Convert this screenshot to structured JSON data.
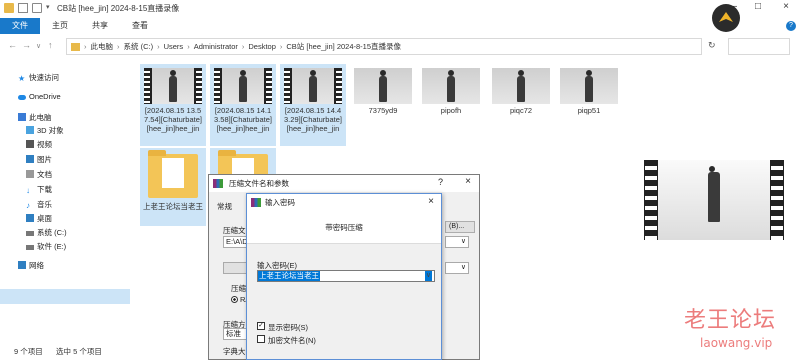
{
  "window": {
    "title": "CB站 [hee_jin] 2024-8-15直播录像",
    "controls": [
      "—",
      "□",
      "×"
    ]
  },
  "ribbon": {
    "tabs": [
      "文件",
      "主页",
      "共享",
      "查看"
    ],
    "help_icon": "?"
  },
  "address": {
    "crumbs": [
      "此电脑",
      "系统 (C:)",
      "Users",
      "Administrator",
      "Desktop",
      "CB站 [hee_jin] 2024-8-15直播录像"
    ],
    "refresh": "↻"
  },
  "sidebar": {
    "items": [
      {
        "label": "快速访问",
        "icon": "star-icon",
        "color": "#1e88e5"
      },
      {
        "label": "OneDrive",
        "icon": "cloud-icon",
        "color": "#1e88e5"
      },
      {
        "label": "此电脑",
        "icon": "computer-icon",
        "color": "#3a7bd5"
      },
      {
        "label": "3D 对象",
        "icon": "cube-icon",
        "color": "#4aa3df"
      },
      {
        "label": "视频",
        "icon": "video-icon",
        "color": "#555"
      },
      {
        "label": "图片",
        "icon": "picture-icon",
        "color": "#2f7fc1"
      },
      {
        "label": "文档",
        "icon": "document-icon",
        "color": "#777"
      },
      {
        "label": "下载",
        "icon": "download-icon",
        "color": "#1e88e5"
      },
      {
        "label": "音乐",
        "icon": "music-icon",
        "color": "#1e88e5"
      },
      {
        "label": "桌面",
        "icon": "desktop-icon",
        "color": "#2f7fc1"
      },
      {
        "label": "系统 (C:)",
        "icon": "drive-icon",
        "color": "#666"
      },
      {
        "label": "软件 (E:)",
        "icon": "drive-icon",
        "color": "#666"
      },
      {
        "label": "网络",
        "icon": "network-icon",
        "color": "#2f7fc1"
      }
    ]
  },
  "files": [
    {
      "name": "[2024.08.15 13.57.54][Chaturbate][hee_jin]hee_jin",
      "type": "video",
      "selected": true
    },
    {
      "name": "[2024.08.15 14.13.58][Chaturbate][hee_jin]hee_jin",
      "type": "video",
      "selected": true
    },
    {
      "name": "[2024.08.15 14.43.29][Chaturbate][hee_jin]hee_jin",
      "type": "video",
      "selected": true
    },
    {
      "name": "7375yd9",
      "type": "image",
      "selected": false
    },
    {
      "name": "pipofh",
      "type": "image",
      "selected": false
    },
    {
      "name": "piqc72",
      "type": "image",
      "selected": false
    },
    {
      "name": "piqp51",
      "type": "image",
      "selected": false
    },
    {
      "name": "上老王论坛当老王",
      "type": "folder",
      "selected": true
    },
    {
      "name": "",
      "type": "folder",
      "selected": true
    }
  ],
  "status": {
    "count": "9 个项目",
    "selected": "选中 5 个项目"
  },
  "dialog_archive": {
    "title": "压缩文件名和参数",
    "help": "?",
    "close": "×",
    "tab": "常规",
    "filename_label": "压缩文",
    "filename_value": "E:\\A\\D",
    "browse": "(B)...",
    "format_label": "压缩",
    "format_option": "RA",
    "method_label": "压缩方",
    "method_value": "标准",
    "dict_label": "字典大"
  },
  "dialog_password": {
    "title": "输入密码",
    "close": "×",
    "header": "带密码压缩",
    "password_label": "输入密码(E)",
    "password_value": "上老王论坛当老王",
    "show_password": "显示密码(S)",
    "show_password_checked": true,
    "encrypt_names": "加密文件名(N)",
    "encrypt_names_checked": false
  },
  "watermark": {
    "cn": "老王论坛",
    "en": "laowang.vip"
  }
}
